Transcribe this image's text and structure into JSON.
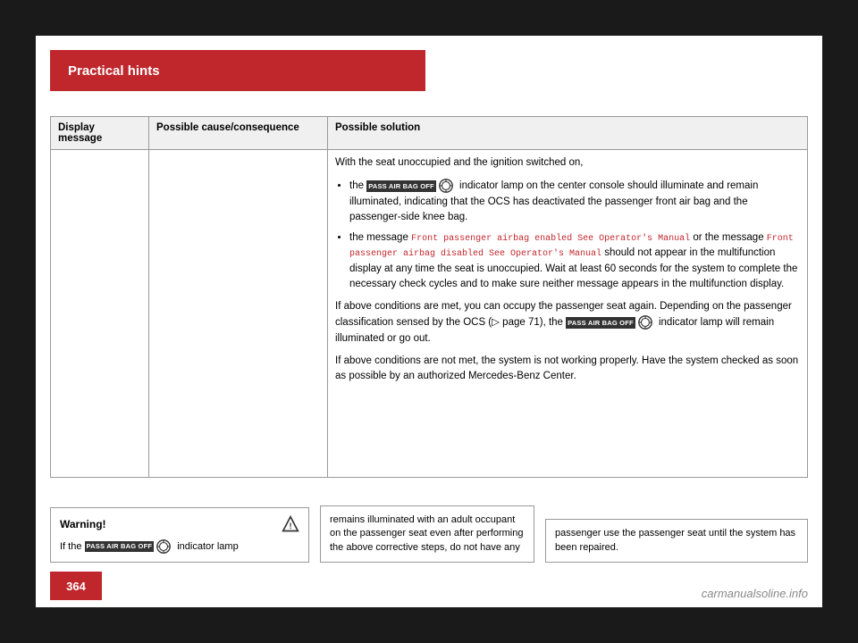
{
  "header": {
    "title": "Practical hints"
  },
  "table": {
    "columns": [
      "Display message",
      "Possible cause/consequence",
      "Possible solution"
    ],
    "solution_intro": "With the seat unoccupied and the ignition switched on,",
    "bullet1_prefix": "the",
    "bullet1_badge": "PASS AIR BAG OFF",
    "bullet1_text": "indicator lamp on the center console should illuminate and remain illuminated, indicating that the OCS has deactivated the passenger front air bag and the passenger-side knee bag.",
    "bullet2_prefix": "the message",
    "bullet2_code1": "Front passenger airbag enabled See Operator's Manual",
    "bullet2_mid": "or the message",
    "bullet2_code2": "Front passenger airbag disabled See Operator's Manual",
    "bullet2_text": "should not appear in the multifunction display at any time the seat is unoccupied. Wait at least 60 seconds for the system to complete the necessary check cycles and to make sure neither message appears in the multifunction display.",
    "para1": "If above conditions are met, you can occupy the passenger seat again. Depending on the passenger classification sensed by the OCS (▷ page 71), the",
    "para1_badge": "PASS AIR BAG OFF",
    "para1_end": "indicator lamp will remain illuminated or go out.",
    "para2": "If above conditions are not met, the system is not working properly. Have the system checked as soon as possible by an authorized Mercedes-Benz Center."
  },
  "warning": {
    "title": "Warning!",
    "text_prefix": "If the",
    "badge": "PASS AIR BAG OFF",
    "text_suffix": "indicator lamp"
  },
  "warning_continues": "remains illuminated with an adult occupant on the passenger seat even after performing the above corrective steps, do not have any",
  "warning_end": "passenger use the passenger seat until the system has been repaired.",
  "page_number": "364",
  "watermark": "carmanualsoline.info"
}
